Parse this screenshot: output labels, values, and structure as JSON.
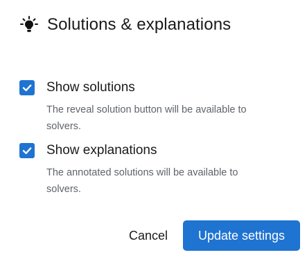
{
  "header": {
    "icon": "lightbulb-icon",
    "title": "Solutions & explanations"
  },
  "options": [
    {
      "label": "Show solutions",
      "description": "The reveal solution button will be available to solvers.",
      "checked": true
    },
    {
      "label": "Show explanations",
      "description": "The annotated solutions will be available to solvers.",
      "checked": true
    }
  ],
  "footer": {
    "cancel_label": "Cancel",
    "update_label": "Update settings"
  },
  "colors": {
    "accent": "#1f73d1",
    "text": "#1a1a1a",
    "muted": "#5f6368"
  }
}
